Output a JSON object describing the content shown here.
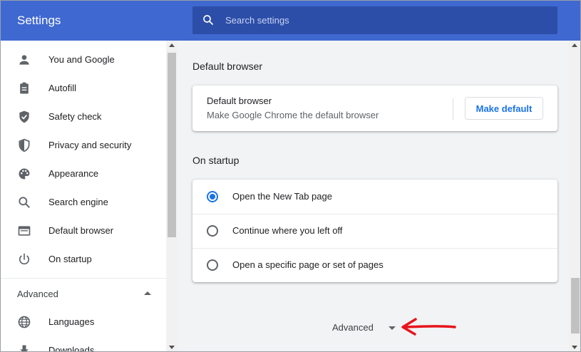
{
  "header": {
    "title": "Settings",
    "search": {
      "placeholder": "Search settings",
      "value": "",
      "icon": "search-icon"
    }
  },
  "sidebar": {
    "items": [
      {
        "label": "You and Google",
        "icon": "person-icon"
      },
      {
        "label": "Autofill",
        "icon": "clipboard-icon"
      },
      {
        "label": "Safety check",
        "icon": "shield-check-icon"
      },
      {
        "label": "Privacy and security",
        "icon": "shield-half-icon"
      },
      {
        "label": "Appearance",
        "icon": "palette-icon"
      },
      {
        "label": "Search engine",
        "icon": "search-icon"
      },
      {
        "label": "Default browser",
        "icon": "browser-window-icon"
      },
      {
        "label": "On startup",
        "icon": "power-icon"
      }
    ],
    "advanced_label": "Advanced",
    "advanced_items": [
      {
        "label": "Languages",
        "icon": "globe-icon"
      },
      {
        "label": "Downloads",
        "icon": "download-icon"
      }
    ]
  },
  "main": {
    "default_browser": {
      "section_title": "Default browser",
      "card_title": "Default browser",
      "card_subtitle": "Make Google Chrome the default browser",
      "button_label": "Make default"
    },
    "on_startup": {
      "section_title": "On startup",
      "options": [
        {
          "label": "Open the New Tab page",
          "selected": true
        },
        {
          "label": "Continue where you left off",
          "selected": false
        },
        {
          "label": "Open a specific page or set of pages",
          "selected": false
        }
      ]
    },
    "advanced_toggle_label": "Advanced"
  },
  "colors": {
    "header": "#3f68d0",
    "search_box": "#2d4ea8",
    "accent": "#1a73e8",
    "annotation_arrow": "#e8141c"
  }
}
